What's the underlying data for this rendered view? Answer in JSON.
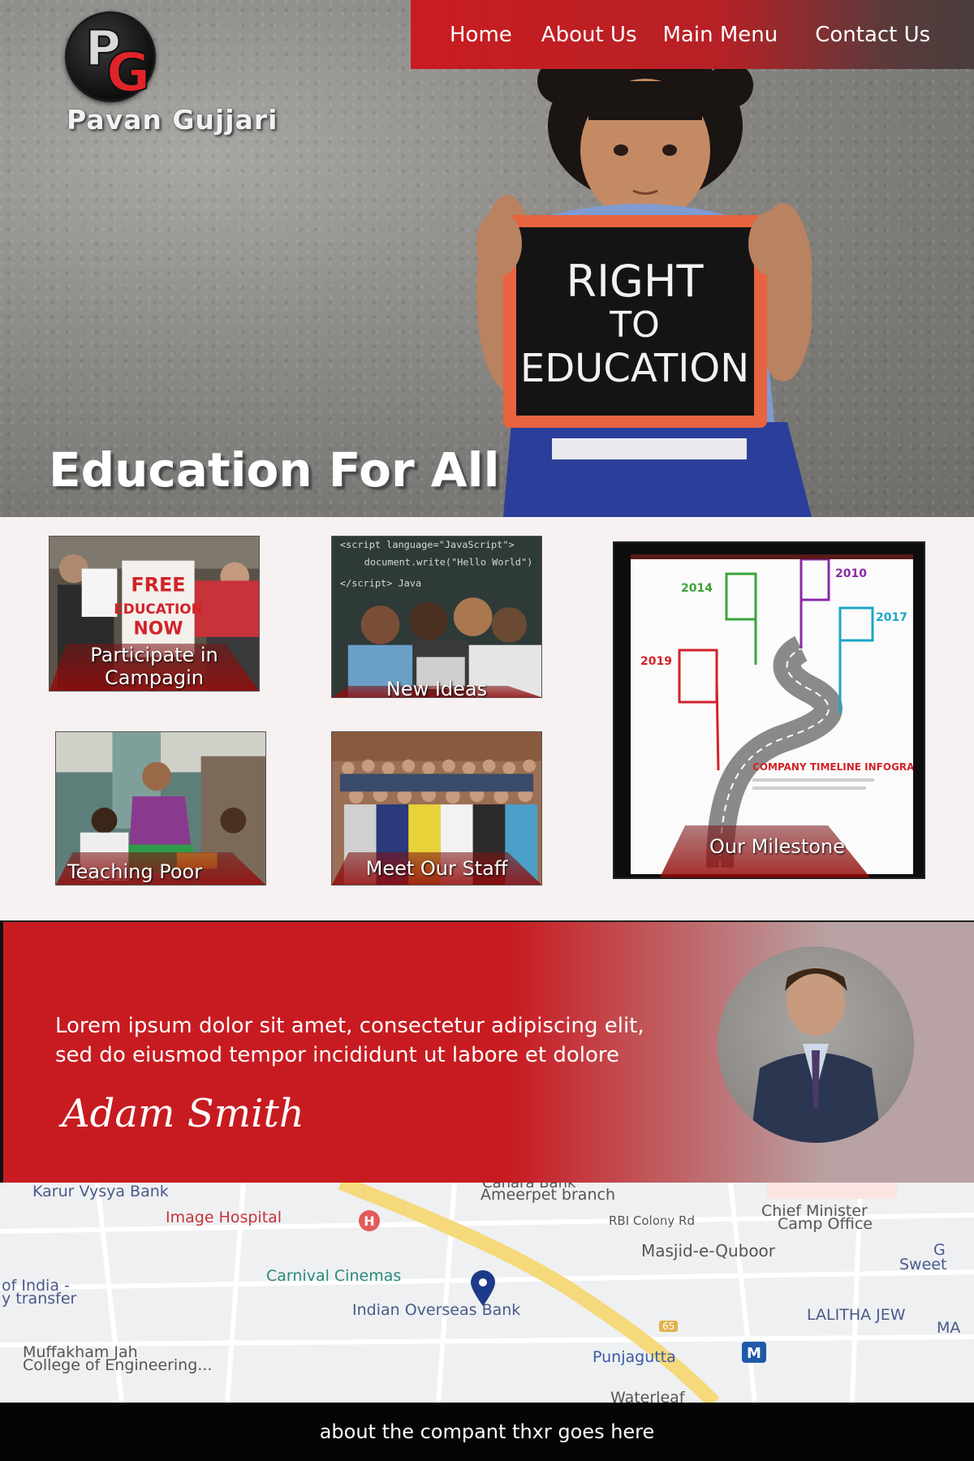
{
  "brand": {
    "logo_letters": [
      "P",
      "G"
    ],
    "name": "Pavan Gujjari"
  },
  "nav": {
    "items": [
      {
        "label": "Home"
      },
      {
        "label": "About Us"
      },
      {
        "label": "Main Menu"
      },
      {
        "label": "Contact Us"
      }
    ]
  },
  "hero": {
    "title": "Education For All",
    "chalkboard_lines": [
      "RIGHT",
      "TO",
      "EDUCATION"
    ]
  },
  "cards": [
    {
      "label_line1": "Participate in",
      "label_line2": "Campagin",
      "sign_text": [
        "FREE",
        "EDUCATION",
        "NOW"
      ]
    },
    {
      "label": "New Ideas"
    },
    {
      "label": "Teaching Poor"
    },
    {
      "label": "Meet Our Staff"
    }
  ],
  "milestone": {
    "label": "Our Milestone",
    "title": "COMPANY TIMELINE INFOGRAPHIC",
    "years": [
      "2014",
      "2010",
      "2017",
      "2019"
    ]
  },
  "testimonial": {
    "quote": "Lorem ipsum dolor sit amet, consectetur adipiscing elit, sed do eiusmod tempor incididunt ut labore et dolore",
    "author": "Adam Smith"
  },
  "map": {
    "places": [
      "Karur Vysya Bank",
      "Canara Bank",
      "Ameerpet branch",
      "Image Hospital",
      "RBI Colony Rd",
      "Chief Minister",
      "Camp Office",
      "Masjid-e-Quboor",
      "Carnival Cinemas",
      "of India -",
      "y transfer",
      "Indian Overseas Bank",
      "LALITHA JEW",
      "MA",
      "Muffakham Jah",
      "College of Engineering...",
      "Punjagutta",
      "Waterleaf",
      "Sweet",
      "G"
    ],
    "road_number": "65"
  },
  "footer": {
    "text": "about the compant thxr goes here"
  },
  "colors": {
    "accent": "#c91c20",
    "nav_end": "#4a3d3d",
    "footer_bg": "#050505",
    "page_bg": "#f8f1f1"
  }
}
